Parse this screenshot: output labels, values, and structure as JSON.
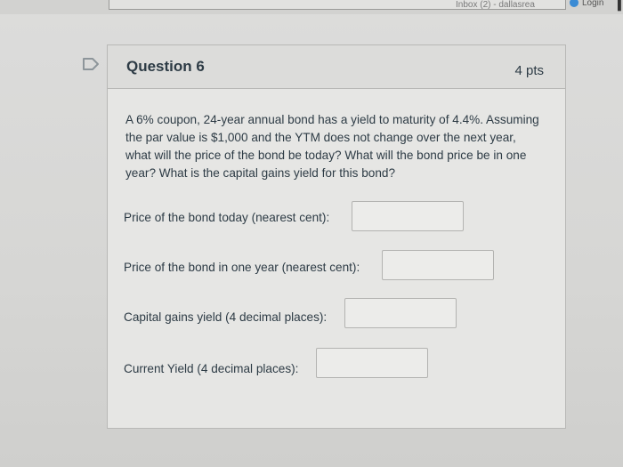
{
  "browser": {
    "tab_fragment_text": "...",
    "inbox_tab": "Inbox (2) - dallasrea",
    "login_label": "Login"
  },
  "question": {
    "title": "Question 6",
    "points": "4 pts",
    "body": "A 6% coupon, 24-year annual bond has a yield to maturity of 4.4%. Assuming the par value is $1,000 and the YTM does not change over the next year, what will the price of the bond be today? What will the bond price be in one year? What is the capital gains yield for this bond?",
    "fields": [
      {
        "label": "Price of the bond today (nearest cent):",
        "value": ""
      },
      {
        "label": "Price of the bond in one year (nearest cent):",
        "value": ""
      },
      {
        "label": "Capital gains yield (4 decimal places):",
        "value": ""
      },
      {
        "label": "Current Yield (4 decimal places):",
        "value": ""
      }
    ]
  }
}
